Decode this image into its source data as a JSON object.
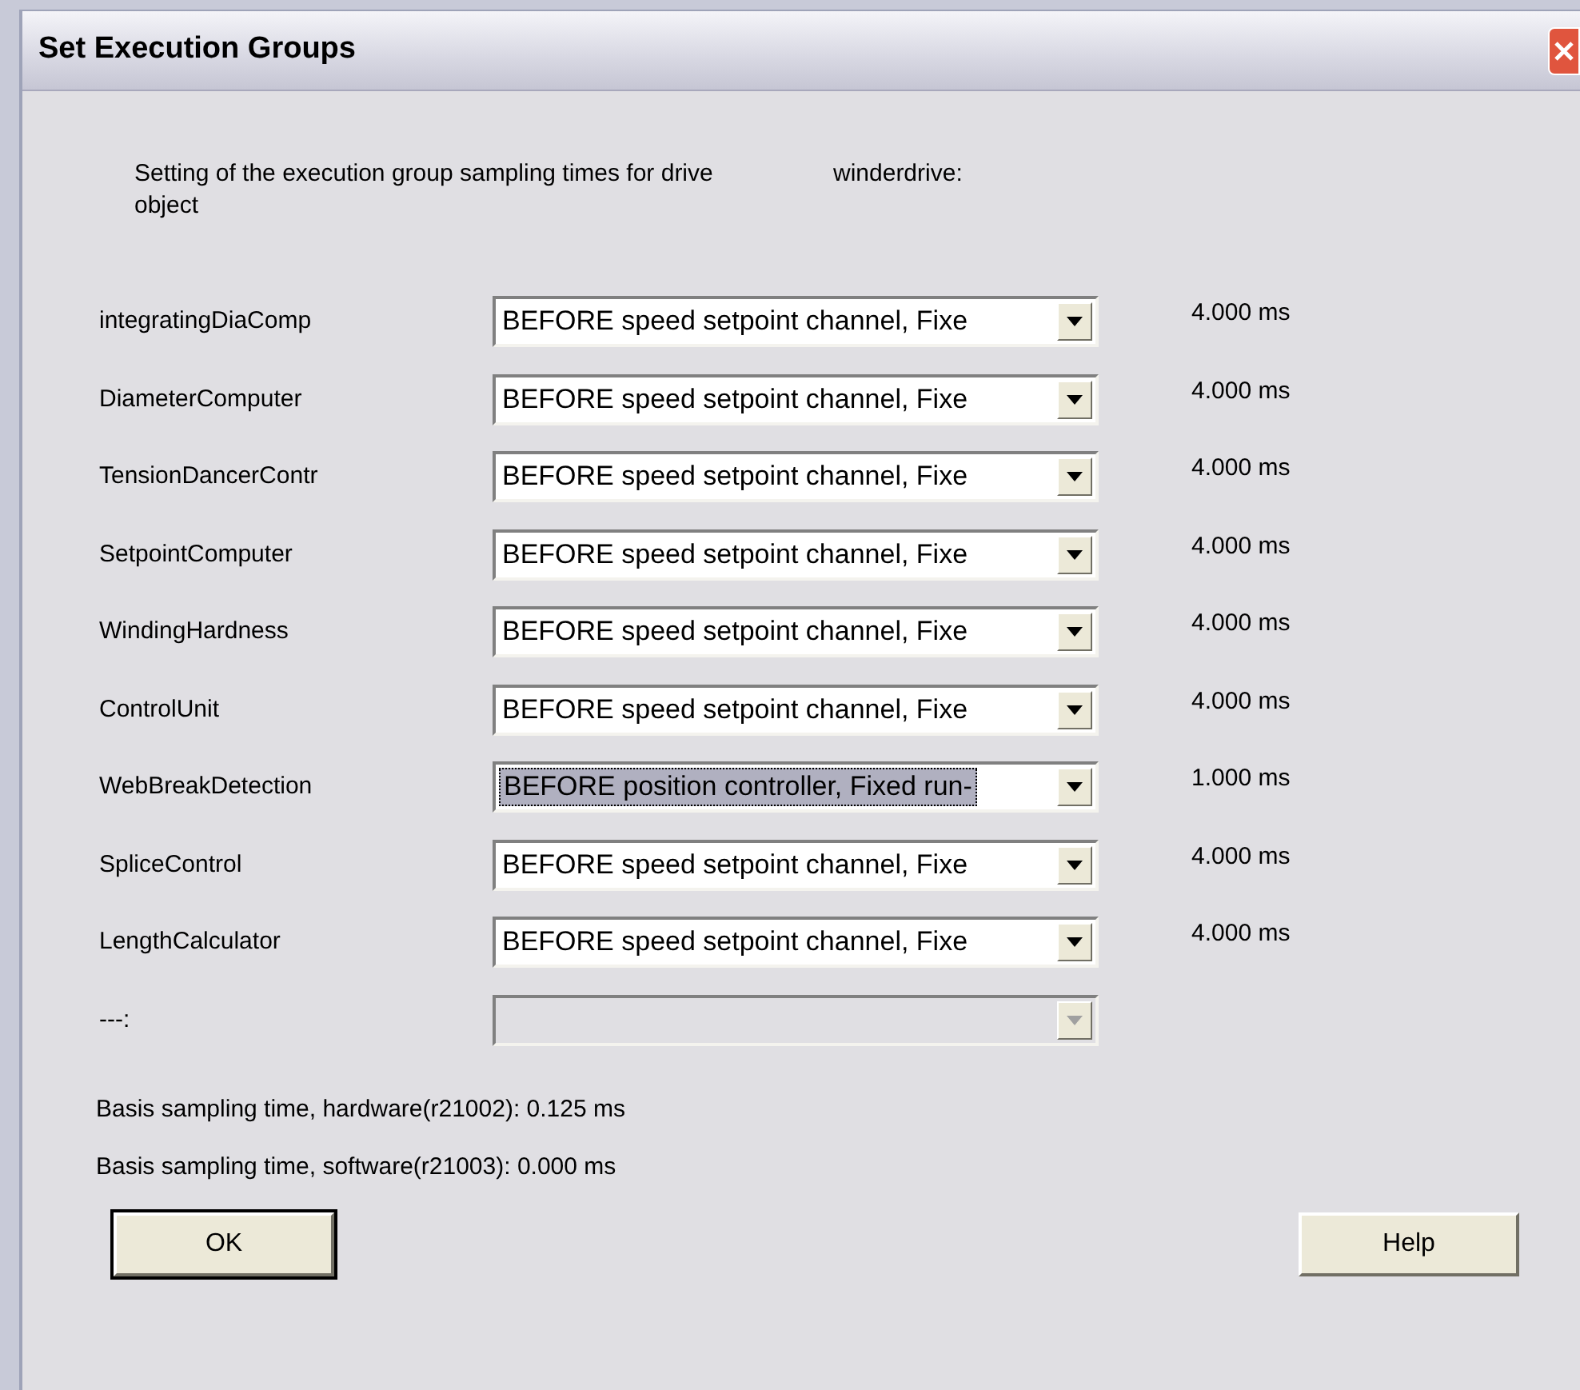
{
  "window": {
    "title": "Set Execution Groups"
  },
  "description": {
    "text": "Setting of the execution group sampling times for drive object",
    "drive": "winderdrive:"
  },
  "rows": [
    {
      "label": "integratingDiaComp",
      "value": "BEFORE speed setpoint channel, Fixe",
      "focused": false,
      "disabled": false,
      "time": "4.000 ms"
    },
    {
      "label": "DiameterComputer",
      "value": "BEFORE speed setpoint channel, Fixe",
      "focused": false,
      "disabled": false,
      "time": "4.000 ms"
    },
    {
      "label": "TensionDancerContr",
      "value": "BEFORE speed setpoint channel, Fixe",
      "focused": false,
      "disabled": false,
      "time": "4.000 ms"
    },
    {
      "label": "SetpointComputer",
      "value": "BEFORE speed setpoint channel, Fixe",
      "focused": false,
      "disabled": false,
      "time": "4.000 ms"
    },
    {
      "label": "WindingHardness",
      "value": "BEFORE speed setpoint channel, Fixe",
      "focused": false,
      "disabled": false,
      "time": "4.000 ms"
    },
    {
      "label": "ControlUnit",
      "value": "BEFORE speed setpoint channel, Fixe",
      "focused": false,
      "disabled": false,
      "time": "4.000 ms"
    },
    {
      "label": "WebBreakDetection",
      "value": "BEFORE position controller, Fixed run-",
      "focused": true,
      "disabled": false,
      "time": "1.000 ms"
    },
    {
      "label": "SpliceControl",
      "value": "BEFORE speed setpoint channel, Fixe",
      "focused": false,
      "disabled": false,
      "time": "4.000 ms"
    },
    {
      "label": "LengthCalculator",
      "value": "BEFORE speed setpoint channel, Fixe",
      "focused": false,
      "disabled": false,
      "time": "4.000 ms"
    },
    {
      "label": "---:",
      "disabled": true
    }
  ],
  "info": [
    "Basis sampling time, hardware(r21002): 0.125 ms",
    "Basis sampling time, software(r21003): 0.000 ms"
  ],
  "buttons": [
    {
      "label": "OK",
      "default": true
    },
    {
      "label": "Help",
      "default": false
    }
  ]
}
